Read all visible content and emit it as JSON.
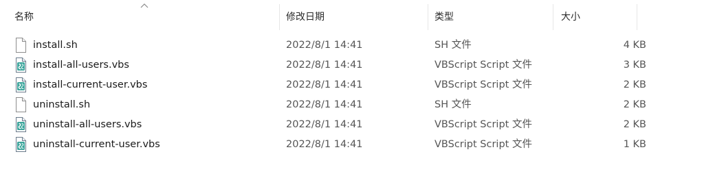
{
  "columns": {
    "name": "名称",
    "date": "修改日期",
    "type": "类型",
    "size": "大小"
  },
  "sort": {
    "column": "name",
    "direction": "ascending"
  },
  "files": [
    {
      "name": "install.sh",
      "date": "2022/8/1 14:41",
      "type": "SH 文件",
      "size": "4 KB",
      "icon": "blank-file-icon"
    },
    {
      "name": "install-all-users.vbs",
      "date": "2022/8/1 14:41",
      "type": "VBScript Script 文件",
      "size": "3 KB",
      "icon": "vbscript-file-icon"
    },
    {
      "name": "install-current-user.vbs",
      "date": "2022/8/1 14:41",
      "type": "VBScript Script 文件",
      "size": "2 KB",
      "icon": "vbscript-file-icon"
    },
    {
      "name": "uninstall.sh",
      "date": "2022/8/1 14:41",
      "type": "SH 文件",
      "size": "2 KB",
      "icon": "blank-file-icon"
    },
    {
      "name": "uninstall-all-users.vbs",
      "date": "2022/8/1 14:41",
      "type": "VBScript Script 文件",
      "size": "2 KB",
      "icon": "vbscript-file-icon"
    },
    {
      "name": "uninstall-current-user.vbs",
      "date": "2022/8/1 14:41",
      "type": "VBScript Script 文件",
      "size": "1 KB",
      "icon": "vbscript-file-icon"
    }
  ]
}
